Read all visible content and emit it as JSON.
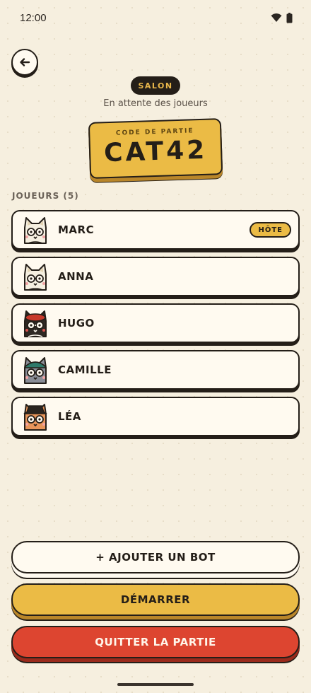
{
  "status_bar": {
    "time": "12:00",
    "icons": [
      "wifi-icon",
      "battery-icon"
    ]
  },
  "header": {
    "back_icon": "arrow-left-icon",
    "badge": "SALON",
    "subtitle": "En attente des joueurs"
  },
  "game_code": {
    "label": "CODE DE PARTIE",
    "value": "CAT42"
  },
  "players": {
    "header": "JOUEURS (5)",
    "host_badge": "HÔTE",
    "items": [
      {
        "name": "MARC",
        "avatar": "white-cat-avatar",
        "is_host": true
      },
      {
        "name": "ANNA",
        "avatar": "white-cat-avatar",
        "is_host": false
      },
      {
        "name": "HUGO",
        "avatar": "black-cat-red-beret-avatar",
        "is_host": false
      },
      {
        "name": "CAMILLE",
        "avatar": "grey-cat-green-cap-avatar",
        "is_host": false
      },
      {
        "name": "LÉA",
        "avatar": "orange-cat-black-hat-avatar",
        "is_host": false
      }
    ]
  },
  "actions": {
    "add_bot": "+ AJOUTER UN BOT",
    "start": "DÉMARRER",
    "quit": "QUITTER LA PARTIE"
  },
  "colors": {
    "background": "#f6efdf",
    "ink": "#241e18",
    "accent_yellow": "#ebbb45",
    "danger_red": "#dd4530",
    "card": "#fffaf0"
  }
}
